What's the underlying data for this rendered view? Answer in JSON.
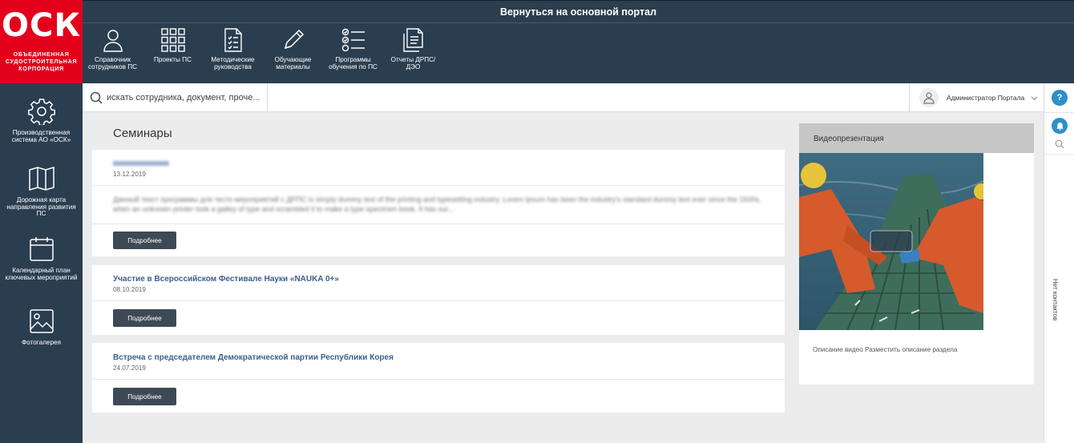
{
  "logo": {
    "mark": "ОСК",
    "subtitle": "ОБЪЕДИНЕННАЯ СУДОСТРОИТЕЛЬНАЯ КОРПОРАЦИЯ"
  },
  "topbar": {
    "portal_link": "Вернуться на основной портал"
  },
  "nav": [
    {
      "label": "Справочник сотрудников ПС",
      "icon": "person-icon"
    },
    {
      "label": "Проекты ПС",
      "icon": "grid-icon"
    },
    {
      "label": "Методические руководства",
      "icon": "document-list-icon"
    },
    {
      "label": "Обучающие материалы",
      "icon": "pencil-icon"
    },
    {
      "label": "Программы обучения по ПС",
      "icon": "checklist-icon"
    },
    {
      "label": "Отчеты ДРПС/ДЭО",
      "icon": "reports-icon"
    }
  ],
  "sidebar": [
    {
      "label": "Производственная система АО «ОСК»",
      "icon": "gear-icon"
    },
    {
      "label": "Дорожная карта направления развития ПС",
      "icon": "map-icon"
    },
    {
      "label": "Календарный план ключевых мероприятий",
      "icon": "calendar-icon"
    },
    {
      "label": "Фотогалерея",
      "icon": "image-icon"
    }
  ],
  "search": {
    "placeholder": "искать сотрудника, документ, проче..."
  },
  "user": {
    "name": "Администратор Портала"
  },
  "rail": {
    "help": "?",
    "no_contacts": "Нет контактов"
  },
  "page": {
    "title": "Семинары"
  },
  "cards": [
    {
      "title": "",
      "date": "13.12.2019",
      "excerpt": "Данный текст программы для тесто мероприятий с ДРПС is simply dummy text of the printing and typesetting industry. Lorem Ipsum has been the industry's standard dummy text ever since the 1500s, when an unknown printer took a galley of type and scrambled it to make a type specimen book. It has sur...",
      "button": "Подробнее"
    },
    {
      "title": "Участие в Всероссийском Фестивале Науки «NAUKA 0+»",
      "date": "08.10.2019",
      "button": "Подробнее"
    },
    {
      "title": "Встреча с председателем Демократической партии Республики Корея",
      "date": "24.07.2019",
      "button": "Подробнее"
    }
  ],
  "video": {
    "heading": "Видеопрезентация",
    "description": "Описание видео Разместить описание раздела"
  },
  "colors": {
    "brand_red": "#e3001b",
    "navy": "#2b3e50",
    "link_blue": "#3a5f8f",
    "accent_blue": "#2e8fc9",
    "button_dark": "#3d4a56"
  }
}
